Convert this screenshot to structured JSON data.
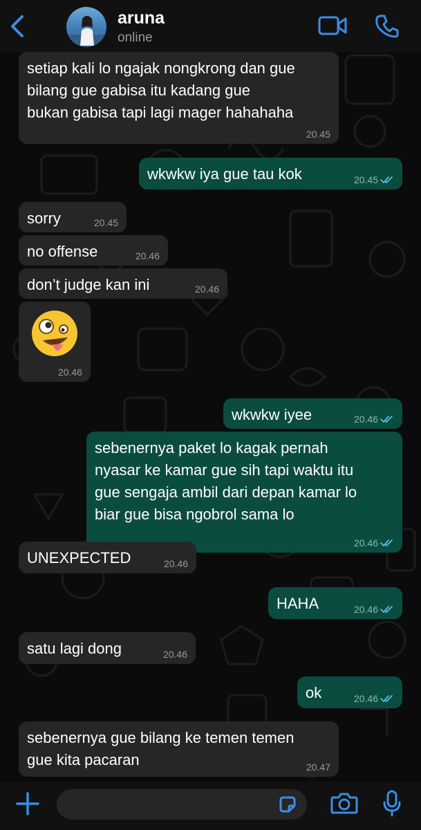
{
  "header": {
    "contact_name": "aruna",
    "contact_status": "online",
    "back_icon": "chevron-left-icon",
    "video_icon": "video-call-icon",
    "phone_icon": "phone-call-icon",
    "accent_color": "#3a8ee6"
  },
  "messages": [
    {
      "dir": "in",
      "text": "setiap kali lo ngajak nongkrong dan gue\nbilang gue gabisa itu kadang gue\nbukan gabisa tapi lagi mager hahahaha",
      "time": "20.45"
    },
    {
      "dir": "out",
      "text": "wkwkw iya gue tau kok",
      "time": "20.45",
      "status": "read"
    },
    {
      "dir": "in",
      "text": "sorry",
      "time": "20.45"
    },
    {
      "dir": "in",
      "text": "no offense",
      "time": "20.46"
    },
    {
      "dir": "in",
      "text": "don’t judge kan ini",
      "time": "20.46"
    },
    {
      "dir": "in",
      "emoji": "zany-face-emoji",
      "time": "20.46"
    },
    {
      "dir": "out",
      "text": "wkwkw iyee",
      "time": "20.46",
      "status": "read"
    },
    {
      "dir": "out",
      "text": "sebenernya paket lo kagak pernah\nnyasar ke kamar gue sih tapi waktu itu\ngue sengaja ambil dari depan kamar lo\nbiar gue bisa ngobrol sama lo",
      "time": "20.46",
      "status": "read"
    },
    {
      "dir": "in",
      "text": "UNEXPECTED",
      "time": "20.46"
    },
    {
      "dir": "out",
      "text": "HAHA",
      "time": "20.46",
      "status": "read"
    },
    {
      "dir": "in",
      "text": "satu lagi dong",
      "time": "20.46"
    },
    {
      "dir": "out",
      "text": "ok",
      "time": "20.46",
      "status": "read"
    },
    {
      "dir": "in",
      "text": "sebenernya gue bilang ke temen temen\ngue kita pacaran",
      "time": "20.47"
    }
  ],
  "input_bar": {
    "plus_icon": "plus-icon",
    "sticker_icon": "sticker-icon",
    "camera_icon": "camera-icon",
    "mic_icon": "microphone-icon",
    "message_value": ""
  },
  "colors": {
    "incoming_bubble": "#262626",
    "outgoing_bubble": "#0b4c40",
    "read_tick": "#53bdeb",
    "background": "#0b0b0b"
  }
}
